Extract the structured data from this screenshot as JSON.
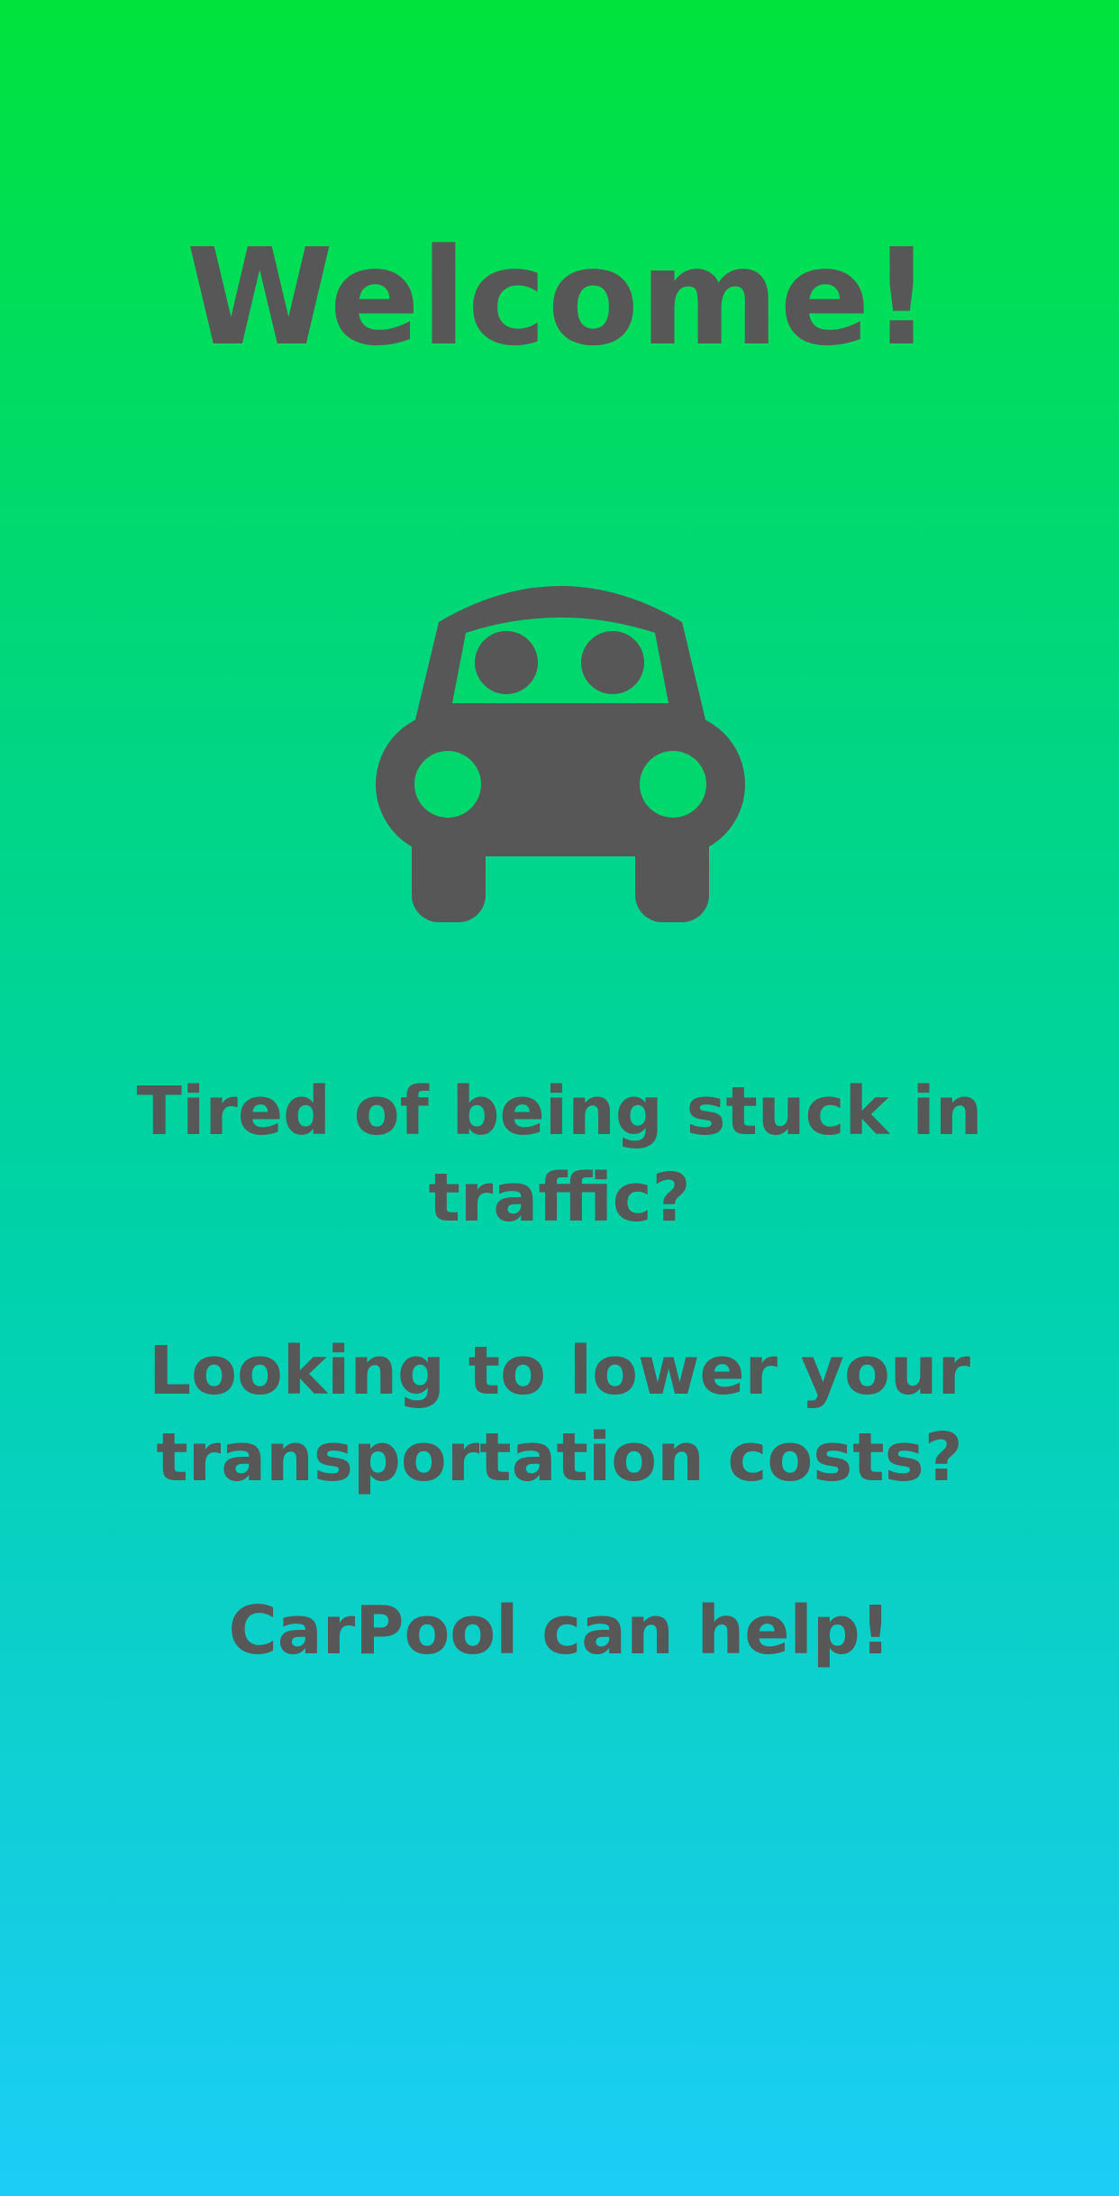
{
  "screen": {
    "title": "Welcome!",
    "hero_icon": "car-icon",
    "lines": [
      "Tired of being stuck in traffic?",
      "Looking to lower your transportation costs?",
      "CarPool can help!"
    ]
  },
  "colors": {
    "gradient_top": "#00e33c",
    "gradient_bottom": "#1ccdf7",
    "text": "#575757"
  }
}
